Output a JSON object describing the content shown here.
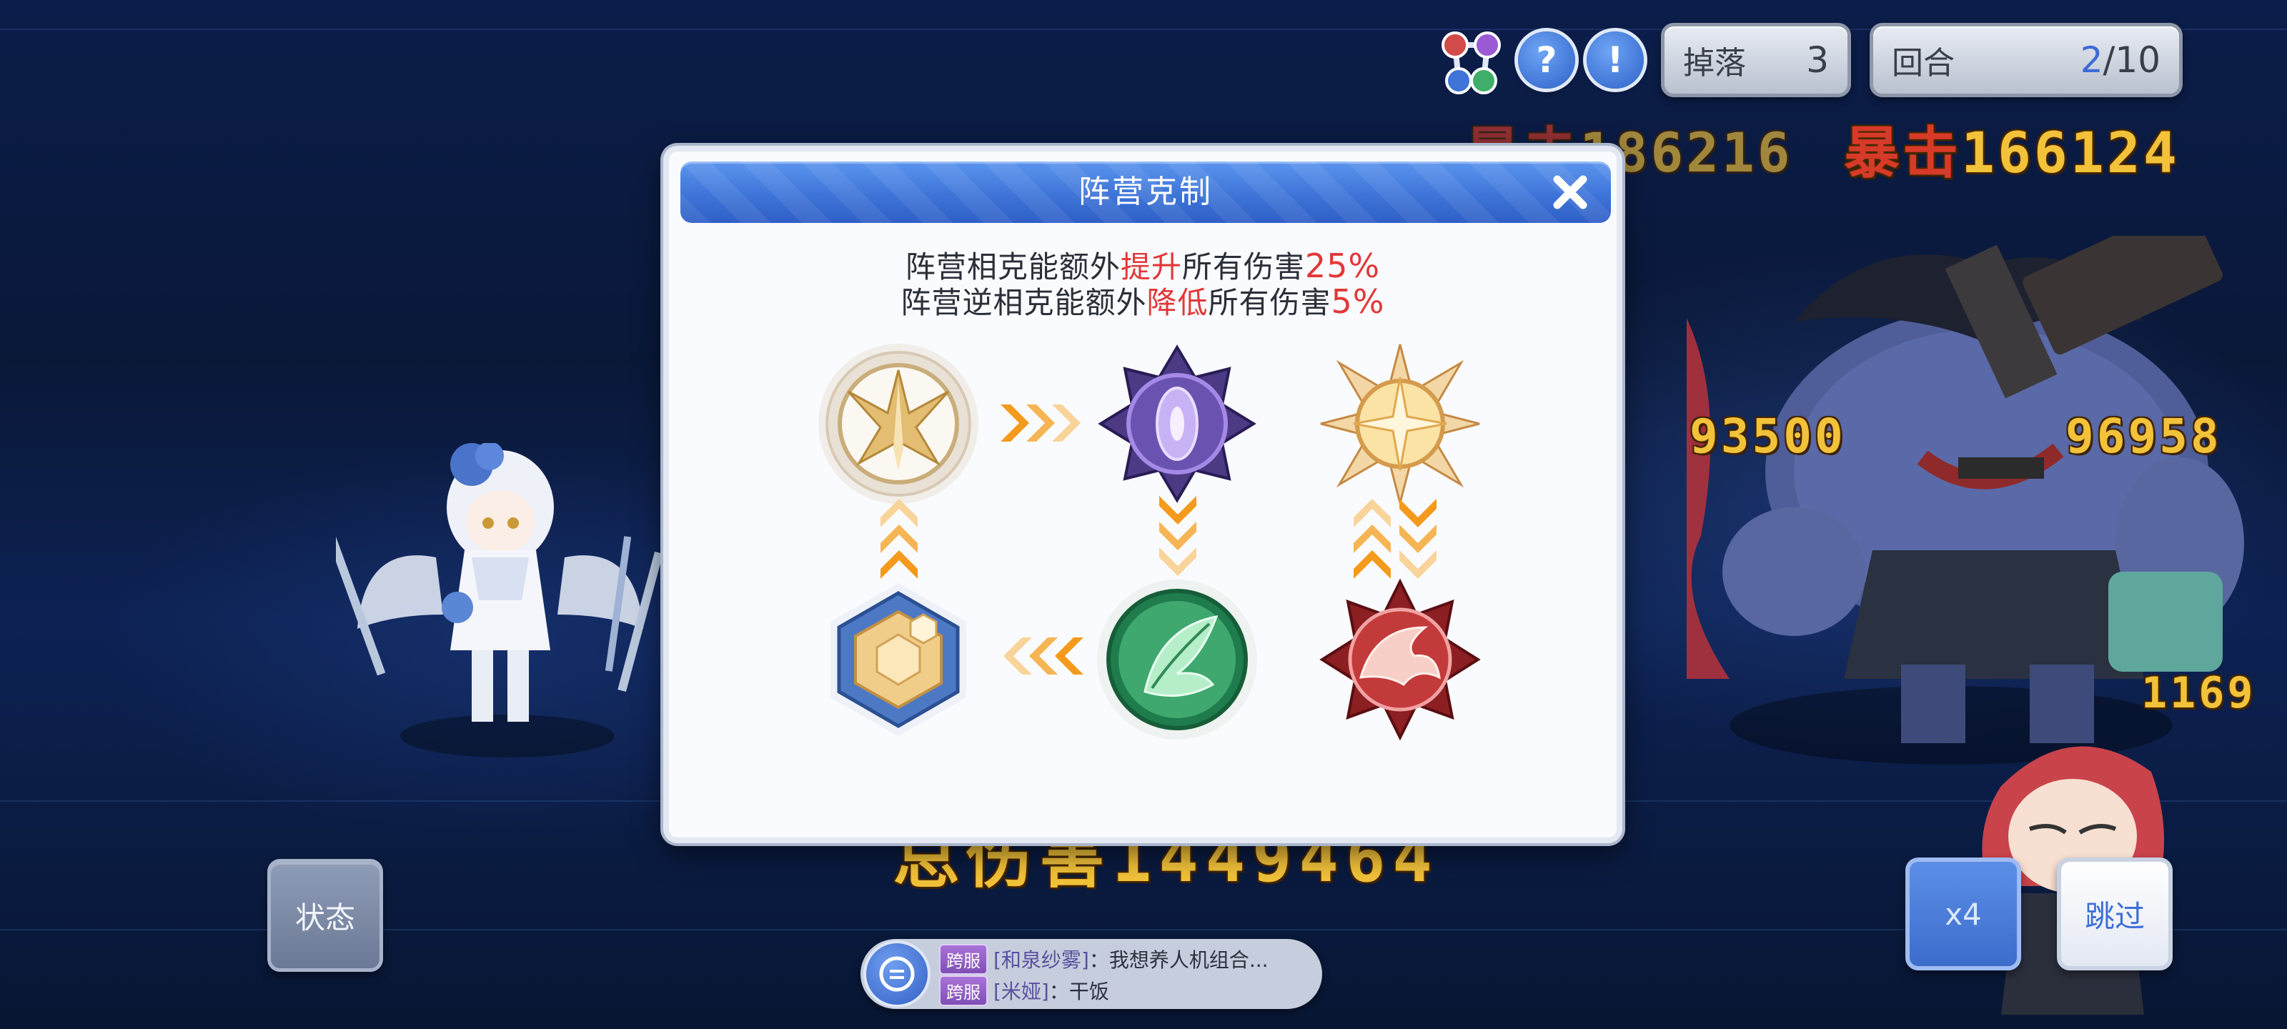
{
  "hud": {
    "drop_label": "掉落",
    "drop_count": "3",
    "round_label": "回合",
    "round_current": "2",
    "round_total": "/10",
    "help_glyph": "?",
    "info_glyph": "!"
  },
  "modal": {
    "title": "阵营克制",
    "line1": {
      "pre": "阵营相克能额外",
      "verb": "提升",
      "mid": "所有伤害",
      "pct": "25%"
    },
    "line2": {
      "pre": "阵营逆相克能额外",
      "verb": "降低",
      "mid": "所有伤害",
      "pct": "5%"
    },
    "emblems": [
      "light-phoenix",
      "shadow-void",
      "holy-star",
      "earth-hex",
      "nature-leaf",
      "fire-dragon"
    ]
  },
  "battle": {
    "damage_numbers": [
      {
        "red": "暴击",
        "value": "186216"
      },
      {
        "red": "暴击",
        "value": "166124"
      },
      {
        "value": "93500"
      },
      {
        "value": "96958"
      },
      {
        "value": "1169"
      }
    ],
    "total_damage": "总伤害1449464"
  },
  "buttons": {
    "status": "状态",
    "speed": "x4",
    "skip": "跳过"
  },
  "chat": {
    "messages": [
      {
        "tag": "跨服",
        "user": "[和泉纱雾]",
        "text": "：我想养人机组合..."
      },
      {
        "tag": "跨服",
        "user": "[米娅]",
        "text": "：干饭"
      }
    ]
  },
  "colors": {
    "accent_blue": "#3e74d8",
    "highlight_red": "#e23838",
    "damage_gold": "#f2c23a"
  }
}
